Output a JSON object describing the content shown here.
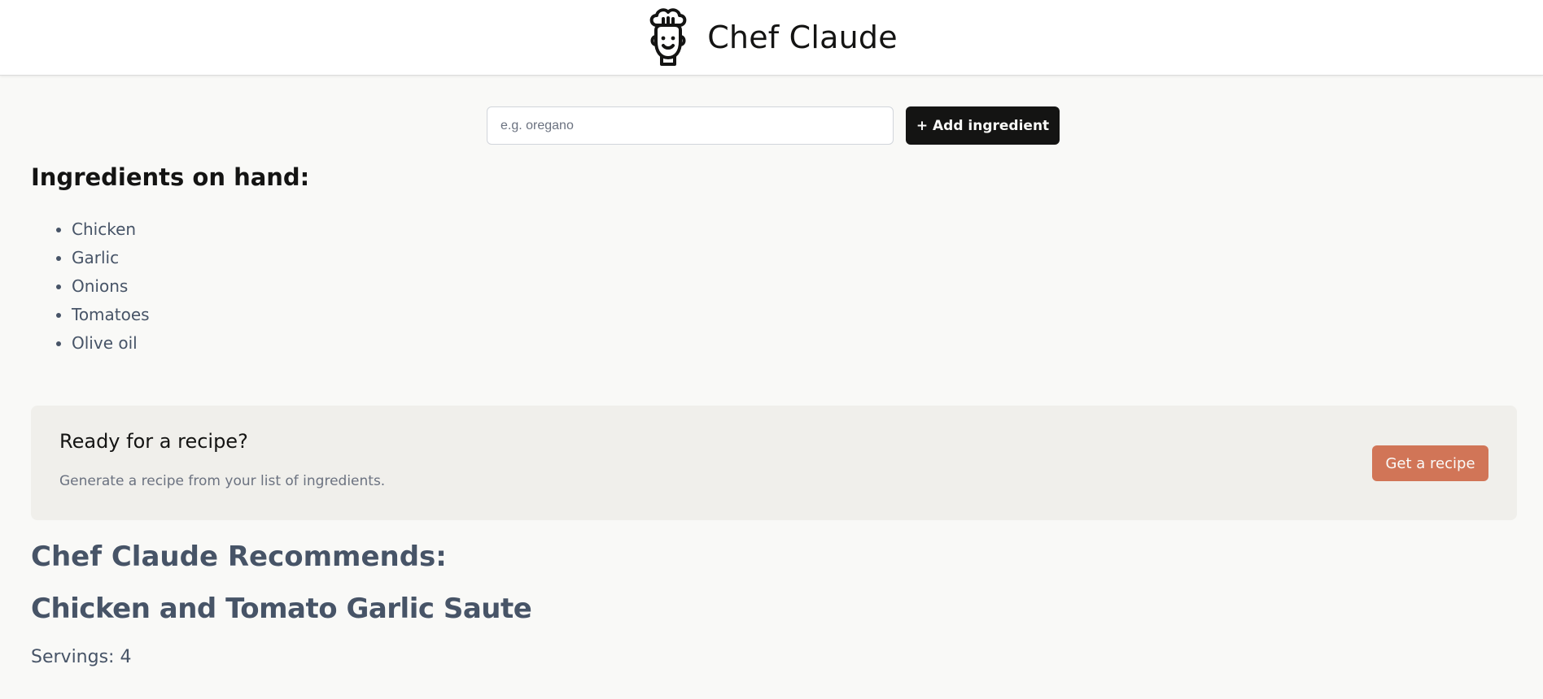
{
  "header": {
    "title": "Chef Claude",
    "logo_icon": "chef-hat-face-icon"
  },
  "form": {
    "placeholder": "e.g. oregano",
    "value": "",
    "add_button_label": "+ Add ingredient"
  },
  "ingredients": {
    "heading": "Ingredients on hand:",
    "items": [
      "Chicken",
      "Garlic",
      "Onions",
      "Tomatoes",
      "Olive oil"
    ]
  },
  "cta": {
    "title": "Ready for a recipe?",
    "subtitle": "Generate a recipe from your list of ingredients.",
    "button_label": "Get a recipe"
  },
  "recipe": {
    "section_heading": "Chef Claude Recommends:",
    "title": "Chicken and Tomato Garlic Saute",
    "servings": "Servings: 4"
  },
  "colors": {
    "background": "#f9f9f7",
    "header_bg": "#ffffff",
    "primary_button": "#141413",
    "accent_button": "#d17557",
    "panel_bg": "#f0efeb",
    "muted_text": "#475467"
  }
}
